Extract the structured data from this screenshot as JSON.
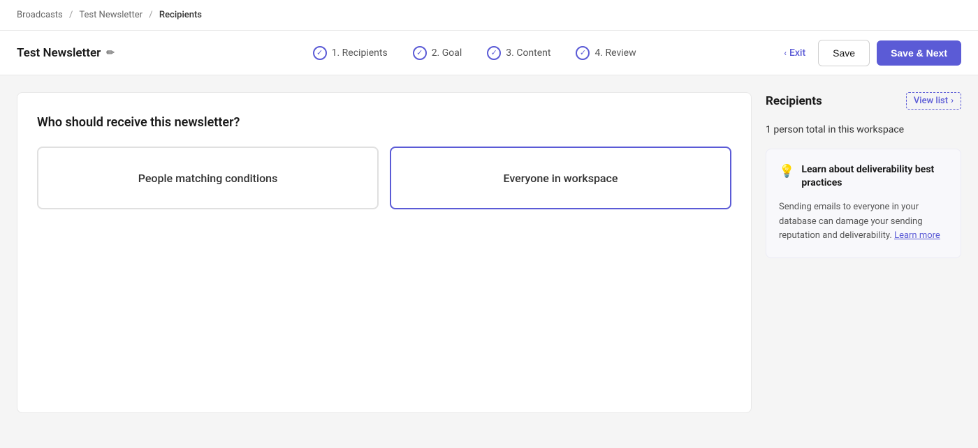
{
  "breadcrumb": {
    "items": [
      {
        "label": "Broadcasts",
        "href": "#"
      },
      {
        "label": "Test Newsletter",
        "href": "#"
      },
      {
        "label": "Recipients",
        "current": true
      }
    ]
  },
  "header": {
    "title": "Test Newsletter",
    "edit_icon": "✏",
    "steps": [
      {
        "number": "1",
        "label": "Recipients",
        "checked": true
      },
      {
        "number": "2",
        "label": "Goal",
        "checked": true
      },
      {
        "number": "3",
        "label": "Content",
        "checked": true
      },
      {
        "number": "4",
        "label": "Review",
        "checked": true
      }
    ],
    "exit_label": "Exit",
    "save_label": "Save",
    "save_next_label": "Save & Next"
  },
  "main": {
    "question": "Who should receive this newsletter?",
    "options": [
      {
        "id": "conditions",
        "label": "People matching conditions",
        "selected": false
      },
      {
        "id": "everyone",
        "label": "Everyone in workspace",
        "selected": true
      }
    ]
  },
  "sidebar": {
    "recipients_title": "Recipients",
    "view_list_label": "View list",
    "chevron": "›",
    "count_text": "1 person total in this workspace",
    "info_card": {
      "title": "Learn about deliverability best practices",
      "body": "Sending emails to everyone in your database can damage your sending reputation and deliverability.",
      "link_label": "Learn more",
      "link_href": "#"
    }
  }
}
